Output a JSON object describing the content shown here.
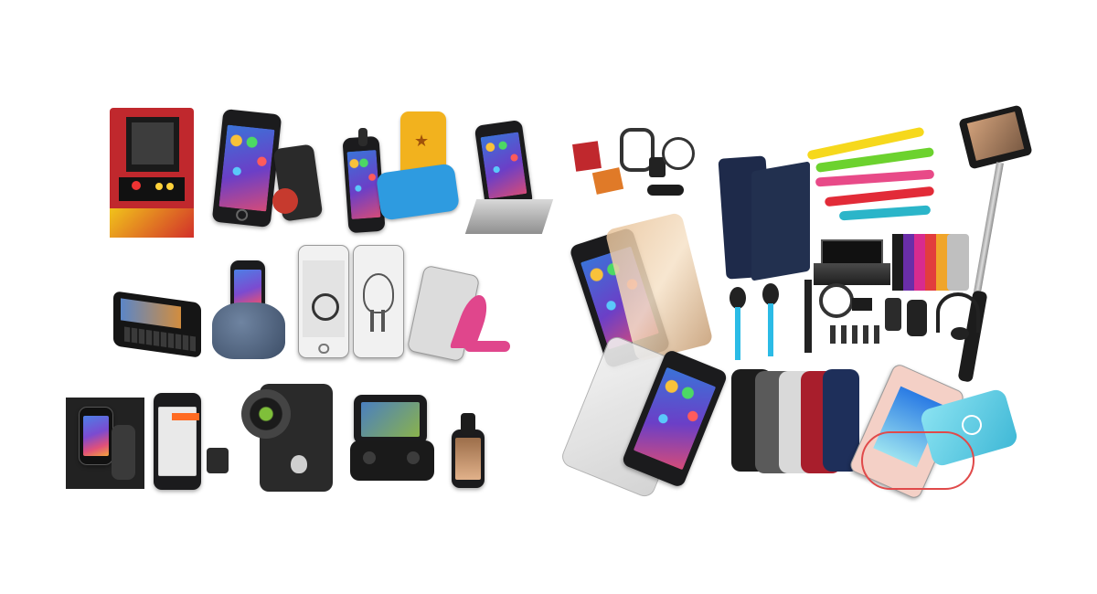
{
  "scene": {
    "description_items": [
      "arcade-cabinet-dock",
      "phone-with-stand",
      "phone-standing",
      "yellow-case",
      "blue-case",
      "phone-in-dock",
      "slide-out-keyboard-phone",
      "beanbag-phone-holder",
      "white-phone-front",
      "phone-skin",
      "pink-shoe-stand",
      "car-mount",
      "audio-dock-phone",
      "fisheye-lens",
      "gamepad-case",
      "clip-lens",
      "charger-kit",
      "flip-case",
      "usb-cables",
      "selfie-stick",
      "mirror-screen-protector",
      "dock-station",
      "colored-cases-stack",
      "earphones",
      "accessory-pack",
      "headset",
      "screen-protector",
      "silicone-cases",
      "power-bank"
    ]
  },
  "colors": {
    "background": "#ffffff",
    "arcade_red": "#c0282d",
    "case_yellow": "#f2b21e",
    "case_blue": "#2e9be0",
    "beanbag": "#4b5f7a",
    "shoe_pink": "#e0468c",
    "flip_navy": "#1e2a4a",
    "earphone_cyan": "#2bbbe6",
    "powerbank_cyan": "#6fd3e8"
  }
}
